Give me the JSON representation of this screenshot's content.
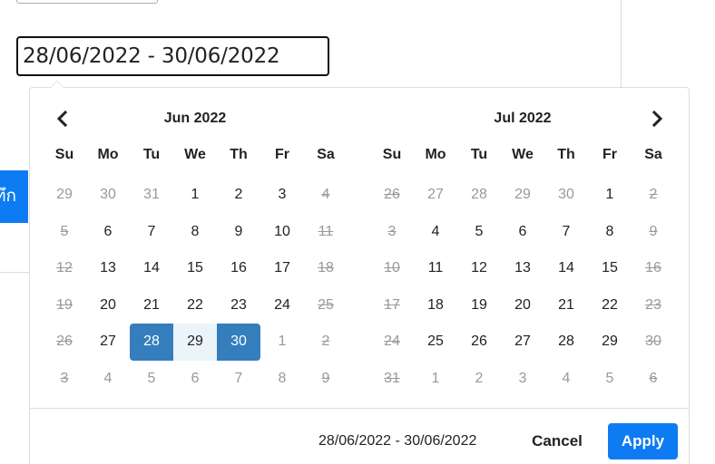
{
  "background": {
    "side_button_label": "ทึก"
  },
  "date_input": {
    "value": "28/06/2022 - 30/06/2022"
  },
  "picker": {
    "prev_icon": "chevron-left-icon",
    "next_icon": "chevron-right-icon",
    "weekdays": [
      "Su",
      "Mo",
      "Tu",
      "We",
      "Th",
      "Fr",
      "Sa"
    ],
    "calendars": [
      {
        "title": "Jun 2022",
        "weeks": [
          [
            "29",
            "30",
            "31",
            "1",
            "2",
            "3",
            "4"
          ],
          [
            "5",
            "6",
            "7",
            "8",
            "9",
            "10",
            "11"
          ],
          [
            "12",
            "13",
            "14",
            "15",
            "16",
            "17",
            "18"
          ],
          [
            "19",
            "20",
            "21",
            "22",
            "23",
            "24",
            "25"
          ],
          [
            "26",
            "27",
            "28",
            "29",
            "30",
            "1",
            "2"
          ],
          [
            "3",
            "4",
            "5",
            "6",
            "7",
            "8",
            "9"
          ]
        ],
        "states": [
          [
            "off",
            "off",
            "off",
            "",
            "",
            "",
            "weekend"
          ],
          [
            "weekend",
            "",
            "",
            "",
            "",
            "",
            "weekend"
          ],
          [
            "weekend",
            "",
            "",
            "",
            "",
            "",
            "weekend"
          ],
          [
            "weekend",
            "",
            "",
            "",
            "",
            "",
            "weekend"
          ],
          [
            "weekend",
            "",
            "start",
            "range",
            "end",
            "off",
            "offweekend"
          ],
          [
            "offweekend",
            "off",
            "off",
            "off",
            "off",
            "off",
            "offweekend"
          ]
        ]
      },
      {
        "title": "Jul 2022",
        "weeks": [
          [
            "26",
            "27",
            "28",
            "29",
            "30",
            "1",
            "2"
          ],
          [
            "3",
            "4",
            "5",
            "6",
            "7",
            "8",
            "9"
          ],
          [
            "10",
            "11",
            "12",
            "13",
            "14",
            "15",
            "16"
          ],
          [
            "17",
            "18",
            "19",
            "20",
            "21",
            "22",
            "23"
          ],
          [
            "24",
            "25",
            "26",
            "27",
            "28",
            "29",
            "30"
          ],
          [
            "31",
            "1",
            "2",
            "3",
            "4",
            "5",
            "6"
          ]
        ],
        "states": [
          [
            "offweekend",
            "off",
            "off",
            "off",
            "off",
            "",
            "weekend"
          ],
          [
            "weekend",
            "",
            "",
            "",
            "",
            "",
            "weekend"
          ],
          [
            "weekend",
            "",
            "",
            "",
            "",
            "",
            "weekend"
          ],
          [
            "weekend",
            "",
            "",
            "",
            "",
            "",
            "weekend"
          ],
          [
            "weekend",
            "",
            "",
            "",
            "",
            "",
            "weekend"
          ],
          [
            "weekend",
            "off",
            "off",
            "off",
            "off",
            "off",
            "offweekend"
          ]
        ]
      }
    ],
    "selected_range_text": "28/06/2022 - 30/06/2022",
    "cancel_label": "Cancel",
    "apply_label": "Apply",
    "colors": {
      "accent": "#0d7cf2",
      "selected": "#357ebd",
      "in_range": "#ebf4f8",
      "muted": "#999999"
    }
  }
}
